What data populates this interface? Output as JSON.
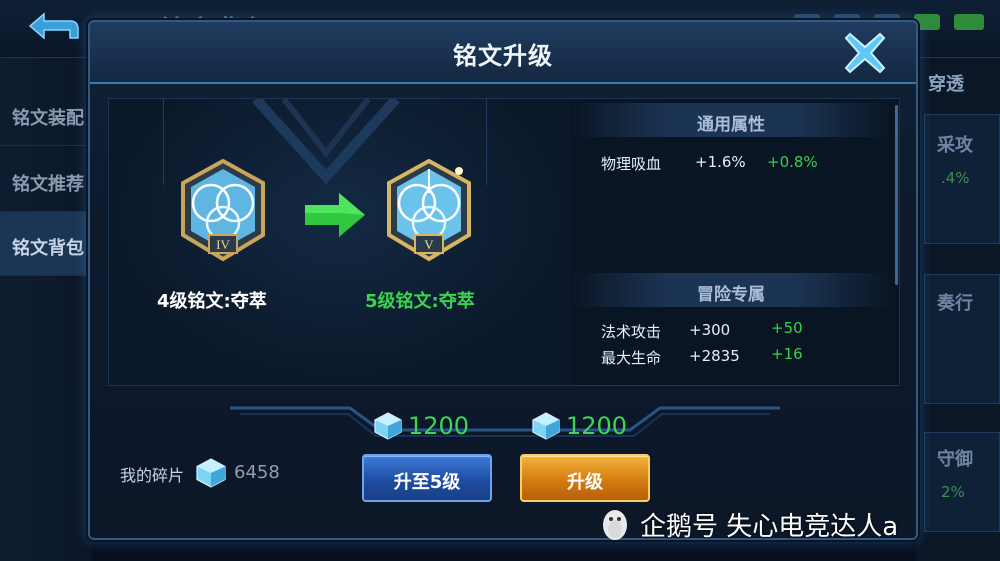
{
  "background": {
    "title": "铭文背包",
    "sidebar": [
      {
        "label": "铭文装配",
        "active": false
      },
      {
        "label": "铭文推荐",
        "active": false
      },
      {
        "label": "铭文背包",
        "active": true
      }
    ],
    "right_tab": "穿透",
    "right_panel_1_text": "采攻",
    "right_panel_1_sub": ".4%",
    "right_panel_2_text": "奏行",
    "right_panel_3_text": "守御",
    "right_panel_3_sub": "2%"
  },
  "modal": {
    "title": "铭文升级",
    "current_rune": {
      "label": "4级铭文:夺萃",
      "level_numeral": "IV"
    },
    "next_rune": {
      "label": "5级铭文:夺萃",
      "level_numeral": "V"
    },
    "general_section": {
      "title": "通用属性",
      "stats": [
        {
          "name": "物理吸血",
          "value": "+1.6%",
          "increase": "+0.8%"
        }
      ]
    },
    "adventure_section": {
      "title": "冒险专属",
      "stats": [
        {
          "name": "法术攻击",
          "value": "+300",
          "increase": "+50"
        },
        {
          "name": "最大生命",
          "value": "+2835",
          "increase": "+16"
        }
      ]
    },
    "cost_upgrade_to_5": "1200",
    "cost_upgrade": "1200",
    "my_shards_label": "我的碎片",
    "my_shards_count": "6458",
    "upgrade_to_5_button": "升至5级",
    "upgrade_button": "升级"
  },
  "watermark": {
    "text": "企鹅号 失心电竞达人a"
  },
  "colors": {
    "accent_green": "#35d34a",
    "panel_border": "#2f5a86",
    "button_blue": "#1f4da3",
    "button_orange": "#d57d12"
  },
  "icons": [
    "back-icon",
    "close-icon",
    "rune-emblem-icon",
    "green-arrow-icon",
    "crystal-shard-icon",
    "penguin-logo-icon"
  ]
}
